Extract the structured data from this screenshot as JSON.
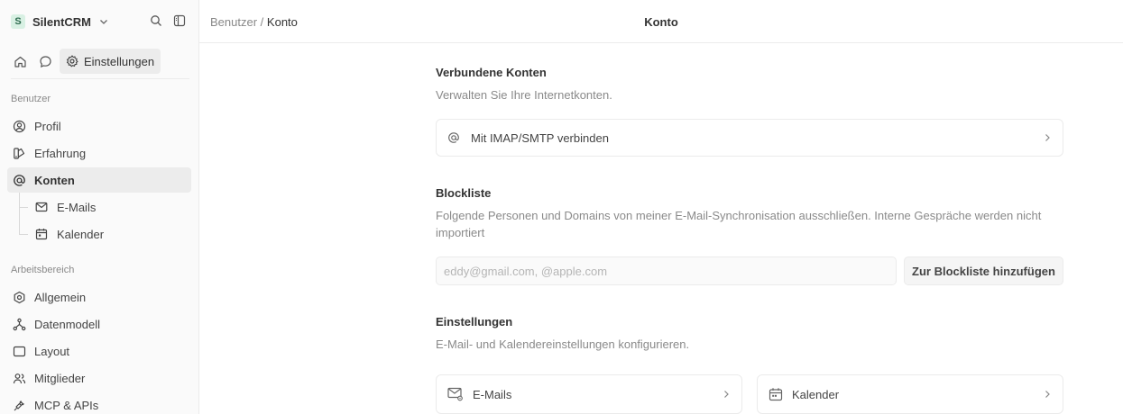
{
  "sidebar": {
    "workspace": {
      "initial": "S",
      "name": "SilentCRM"
    },
    "settings_label": "Einstellungen",
    "sections": [
      {
        "label": "Benutzer"
      },
      {
        "label": "Arbeitsbereich"
      }
    ],
    "user_items": [
      {
        "label": "Profil",
        "icon": "user-circle-icon"
      },
      {
        "label": "Erfahrung",
        "icon": "appearance-icon"
      },
      {
        "label": "Konten",
        "icon": "at-icon",
        "active": true
      },
      {
        "label": "E-Mails",
        "icon": "mail-icon"
      },
      {
        "label": "Kalender",
        "icon": "calendar-icon"
      }
    ],
    "workspace_items": [
      {
        "label": "Allgemein",
        "icon": "hexagon-icon"
      },
      {
        "label": "Datenmodell",
        "icon": "hierarchy-icon"
      },
      {
        "label": "Layout",
        "icon": "layout-icon"
      },
      {
        "label": "Mitglieder",
        "icon": "users-icon"
      },
      {
        "label": "MCP & APIs",
        "icon": "plug-icon"
      }
    ]
  },
  "topbar": {
    "breadcrumb": {
      "parent": "Benutzer",
      "separator": "/",
      "current": "Konto"
    },
    "title": "Konto"
  },
  "main": {
    "connected": {
      "title": "Verbundene Konten",
      "description": "Verwalten Sie Ihre Internetkonten.",
      "imap_label": "Mit IMAP/SMTP verbinden"
    },
    "blocklist": {
      "title": "Blockliste",
      "description": "Folgende Personen und Domains von meiner E-Mail-Synchronisation ausschließen. Interne Gespräche werden nicht importiert",
      "placeholder": "eddy@gmail.com, @apple.com",
      "add_button": "Zur Blockliste hinzufügen"
    },
    "settings": {
      "title": "Einstellungen",
      "description": "E-Mail- und Kalendereinstellungen konfigurieren.",
      "cards": [
        {
          "label": "E-Mails"
        },
        {
          "label": "Kalender"
        }
      ]
    }
  },
  "colors": {
    "sidebar_bg": "#fafafa",
    "active_bg": "#ececec",
    "border": "#ebebeb",
    "muted_text": "#8a8a8a"
  }
}
